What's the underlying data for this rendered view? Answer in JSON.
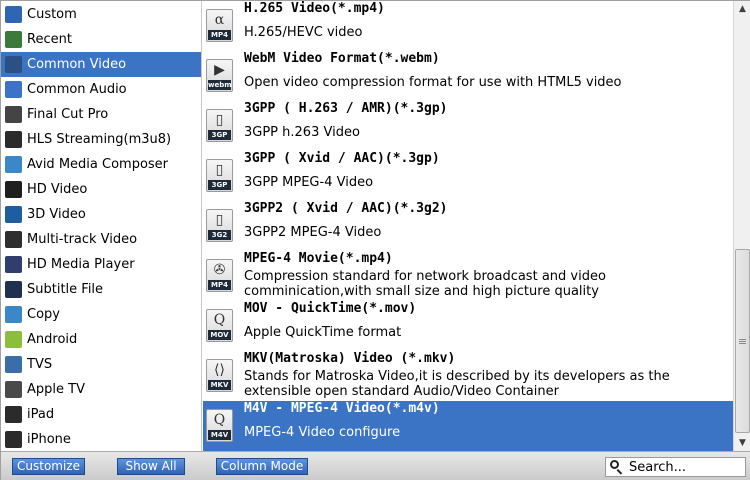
{
  "categories": [
    {
      "label": "Custom",
      "icon": "custom-icon",
      "color": "#2f66b3"
    },
    {
      "label": "Recent",
      "icon": "recent-icon",
      "color": "#3a7a3a"
    },
    {
      "label": "Common Video",
      "icon": "common-video-icon",
      "color": "#2c4f86",
      "selected": true
    },
    {
      "label": "Common Audio",
      "icon": "common-audio-icon",
      "color": "#3b73c9"
    },
    {
      "label": "Final Cut Pro",
      "icon": "final-cut-pro-icon",
      "color": "#444444"
    },
    {
      "label": "HLS Streaming(m3u8)",
      "icon": "hls-streaming-icon",
      "color": "#2b2b2b",
      "glyph": "M3"
    },
    {
      "label": "Avid Media Composer",
      "icon": "avid-media-composer-icon",
      "color": "#3a88c8"
    },
    {
      "label": "HD Video",
      "icon": "hd-video-icon",
      "color": "#1f1f1f",
      "glyph": "HD"
    },
    {
      "label": "3D Video",
      "icon": "3d-video-icon",
      "color": "#1d5f9e",
      "glyph": "3D"
    },
    {
      "label": "Multi-track Video",
      "icon": "multi-track-video-icon",
      "color": "#2e2e2e"
    },
    {
      "label": "HD Media Player",
      "icon": "hd-media-player-icon",
      "color": "#2e3f6e"
    },
    {
      "label": "Subtitle File",
      "icon": "subtitle-file-icon",
      "color": "#1f3050",
      "glyph": "SRT"
    },
    {
      "label": "Copy",
      "icon": "copy-icon",
      "color": "#3a88c8"
    },
    {
      "label": "Android",
      "icon": "android-icon",
      "color": "#8bbf3a"
    },
    {
      "label": "TVS",
      "icon": "tv-icon",
      "color": "#3a6ea8"
    },
    {
      "label": "Apple TV",
      "icon": "apple-tv-icon",
      "color": "#4a4a4a"
    },
    {
      "label": "iPad",
      "icon": "ipad-icon",
      "color": "#2b2b2b"
    },
    {
      "label": "iPhone",
      "icon": "iphone-icon",
      "color": "#2b2b2b"
    }
  ],
  "formats": [
    {
      "title": "H.265 Video(*.mp4)",
      "desc": "H.265/HEVC video",
      "icon": "mp4-file-icon",
      "tag": "MP4",
      "glyph": "α"
    },
    {
      "title": "WebM Video Format(*.webm)",
      "desc": "Open video compression format for use with HTML5 video",
      "icon": "webm-file-icon",
      "tag": "webm",
      "glyph": "▶"
    },
    {
      "title": "3GPP ( H.263 / AMR)(*.3gp)",
      "desc": "3GPP h.263 Video",
      "icon": "3gp-file-icon",
      "tag": "3GP",
      "glyph": "▯"
    },
    {
      "title": "3GPP ( Xvid / AAC)(*.3gp)",
      "desc": "3GPP MPEG-4 Video",
      "icon": "3gp-file-icon",
      "tag": "3GP",
      "glyph": "▯"
    },
    {
      "title": "3GPP2 ( Xvid / AAC)(*.3g2)",
      "desc": "3GPP2 MPEG-4 Video",
      "icon": "3g2-file-icon",
      "tag": "3G2",
      "glyph": "▯"
    },
    {
      "title": "MPEG-4 Movie(*.mp4)",
      "desc": "Compression standard for network broadcast and video comminication,with small size and high picture quality",
      "icon": "mp4-film-reel-icon",
      "tag": "MP4",
      "glyph": "✇"
    },
    {
      "title": "MOV - QuickTime(*.mov)",
      "desc": "Apple QuickTime format",
      "icon": "quicktime-mov-icon",
      "tag": "MOV",
      "glyph": "Q"
    },
    {
      "title": "MKV(Matroska) Video (*.mkv)",
      "desc": "Stands for Matroska Video,it is described by its developers as the extensible open standard Audio/Video Container",
      "icon": "mkv-file-icon",
      "tag": "MKV",
      "glyph": "⟨⟩"
    },
    {
      "title": "M4V - MPEG-4 Video(*.m4v)",
      "desc": "MPEG-4 Video configure",
      "icon": "m4v-file-icon",
      "tag": "M4V",
      "glyph": "Q",
      "selected": true
    }
  ],
  "toolbar": {
    "customize_label": "Customize",
    "show_all_label": "Show All",
    "column_mode_label": "Column Mode"
  },
  "search": {
    "placeholder": "Search..."
  },
  "colors": {
    "selection": "#3b74c5",
    "button": "#3b74c5"
  }
}
